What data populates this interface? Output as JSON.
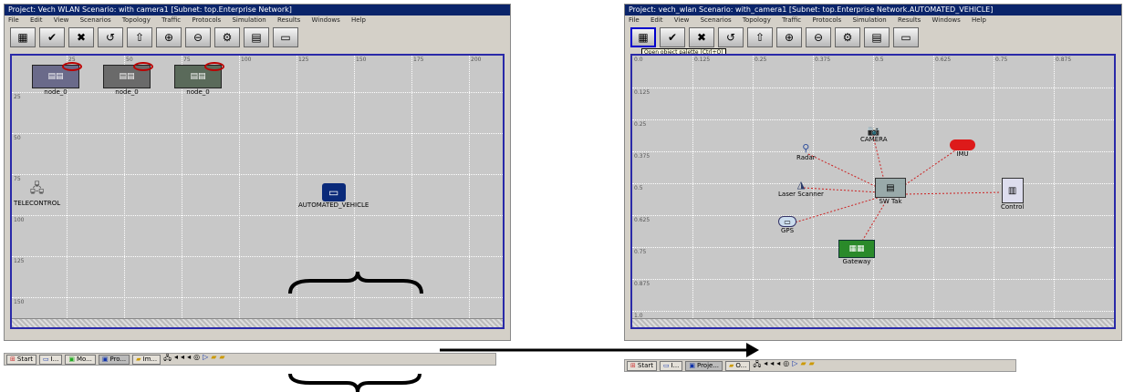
{
  "left_window": {
    "title": "Project: Vech  WLAN Scenario: with  camera1  [Subnet: top.Enterprise Network]",
    "menu": [
      "File",
      "Edit",
      "View",
      "Scenarios",
      "Topology",
      "Traffic",
      "Protocols",
      "Simulation",
      "Results",
      "Windows",
      "Help"
    ],
    "toolbar_icons": [
      "open-object-palette-icon",
      "check-link-consistency-icon",
      "fail-node-icon",
      "recover-node-icon",
      "return-to-parent-icon",
      "zoom-icon",
      "restore-zoom-icon",
      "configure-discrete-event-sim-icon",
      "view-results-icon",
      "hide-statistics-icon"
    ],
    "x_ticks": [
      "0",
      "25",
      "50",
      "75",
      "100",
      "125",
      "150",
      "175",
      "200"
    ],
    "y_ticks": [
      "0",
      "25",
      "50",
      "75",
      "100",
      "125",
      "150",
      "175",
      "200"
    ],
    "nodes": [
      {
        "name": "node_0"
      },
      {
        "name": "node_0"
      },
      {
        "name": "node_0"
      },
      {
        "name": "TELECONTROL"
      },
      {
        "name": "AUTOMATED_VEHICLE"
      }
    ]
  },
  "right_window": {
    "title": "Project: vech_wlan Scenario: with_camera1 [Subnet: top.Enterprise Network.AUTOMATED_VEHICLE]",
    "menu": [
      "File",
      "Edit",
      "View",
      "Scenarios",
      "Topology",
      "Traffic",
      "Protocols",
      "Simulation",
      "Results",
      "Windows",
      "Help"
    ],
    "tooltip": "Open object palette (Ctrl+O)",
    "x_ticks": [
      "0.0",
      "0.125",
      "0.25",
      "0.375",
      "0.5",
      "0.625",
      "0.75",
      "0.875"
    ],
    "y_ticks": [
      "0.0",
      "0.125",
      "0.25",
      "0.375",
      "0.5",
      "0.625",
      "0.75",
      "0.875",
      "1.0"
    ],
    "nodes": [
      {
        "name": "CAMERA"
      },
      {
        "name": "Radar"
      },
      {
        "name": "Laser Scanner"
      },
      {
        "name": "GPS"
      },
      {
        "name": "IMU"
      },
      {
        "name": "SW Tak"
      },
      {
        "name": "Gateway"
      },
      {
        "name": "Control"
      }
    ]
  },
  "taskbar_left": {
    "start": "Start",
    "items": [
      "I...",
      "Mo...",
      "Pro...",
      "Im..."
    ]
  },
  "taskbar_right": {
    "start": "Start",
    "items": [
      "I...",
      "Proje...",
      "O..."
    ]
  },
  "colors": {
    "title_bg": "#0a246a",
    "workspace": "#c8c8c8",
    "frame": "#2a2aa8",
    "link": "#cc2222"
  }
}
